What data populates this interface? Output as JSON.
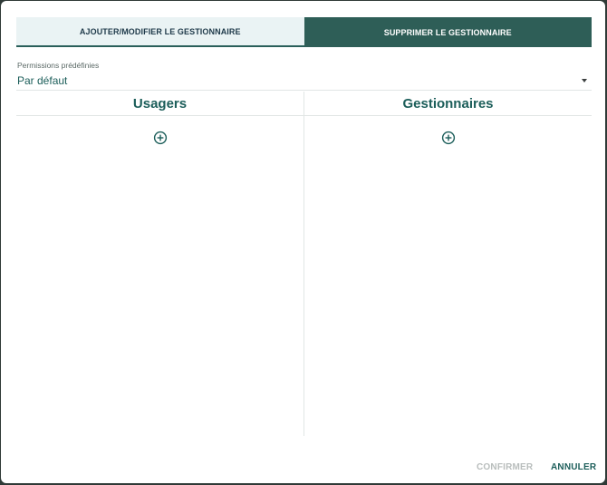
{
  "tabs": [
    {
      "label": "AJOUTER/MODIFIER LE GESTIONNAIRE",
      "active": true
    },
    {
      "label": "SUPPRIMER LE GESTIONNAIRE",
      "active": false
    }
  ],
  "permissions": {
    "label": "Permissions prédéfinies",
    "selected": "Par défaut"
  },
  "columns": {
    "users_title": "Usagers",
    "managers_title": "Gestionnaires"
  },
  "icons": {
    "add": "plus-circle-icon",
    "dropdown": "caret-down-icon"
  },
  "footer": {
    "confirm_label": "CONFIRMER",
    "cancel_label": "ANNULER"
  },
  "colors": {
    "accent": "#1c5e5a",
    "tab_inactive_bg": "#2e5e57",
    "tab_active_bg": "#eaf3f4",
    "disabled_text": "#b8bdbc"
  }
}
